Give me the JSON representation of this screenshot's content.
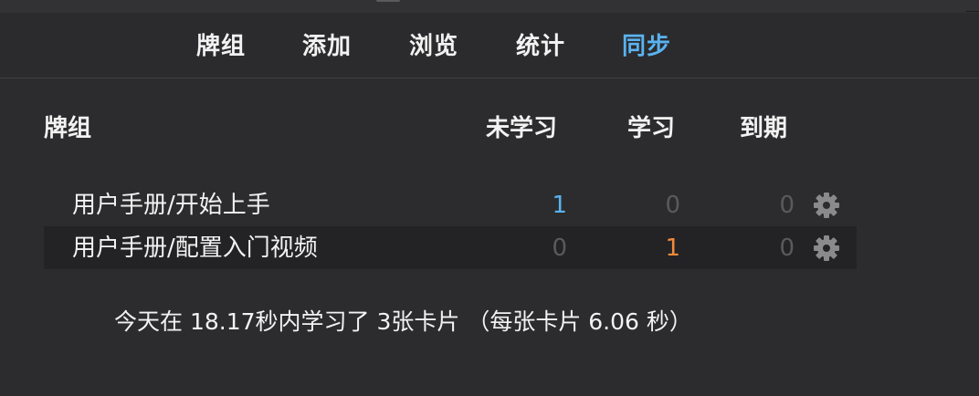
{
  "nav": {
    "items": [
      {
        "label": "牌组",
        "active": false
      },
      {
        "label": "添加",
        "active": false
      },
      {
        "label": "浏览",
        "active": false
      },
      {
        "label": "统计",
        "active": false
      },
      {
        "label": "同步",
        "active": true
      }
    ]
  },
  "table": {
    "headers": {
      "deck": "牌组",
      "new": "未学习",
      "learn": "学习",
      "due": "到期"
    },
    "rows": [
      {
        "name": "用户手册/开始上手",
        "new": "1",
        "learn": "0",
        "due": "0",
        "options_icon": "gear-icon"
      },
      {
        "name": "用户手册/配置入门视频",
        "new": "0",
        "learn": "1",
        "due": "0",
        "options_icon": "gear-icon"
      }
    ]
  },
  "footer": {
    "studied_today": "今天在 18.17秒内学习了 3张卡片 （每张卡片 6.06 秒）"
  },
  "colors": {
    "background": "#2c2c2e",
    "text": "#f2f2f2",
    "active_nav": "#5ab3f0",
    "new_count": "#5ab3f0",
    "learn_count": "#f08a3c",
    "zero_count": "#5a5a5c",
    "alt_row": "#232325"
  }
}
